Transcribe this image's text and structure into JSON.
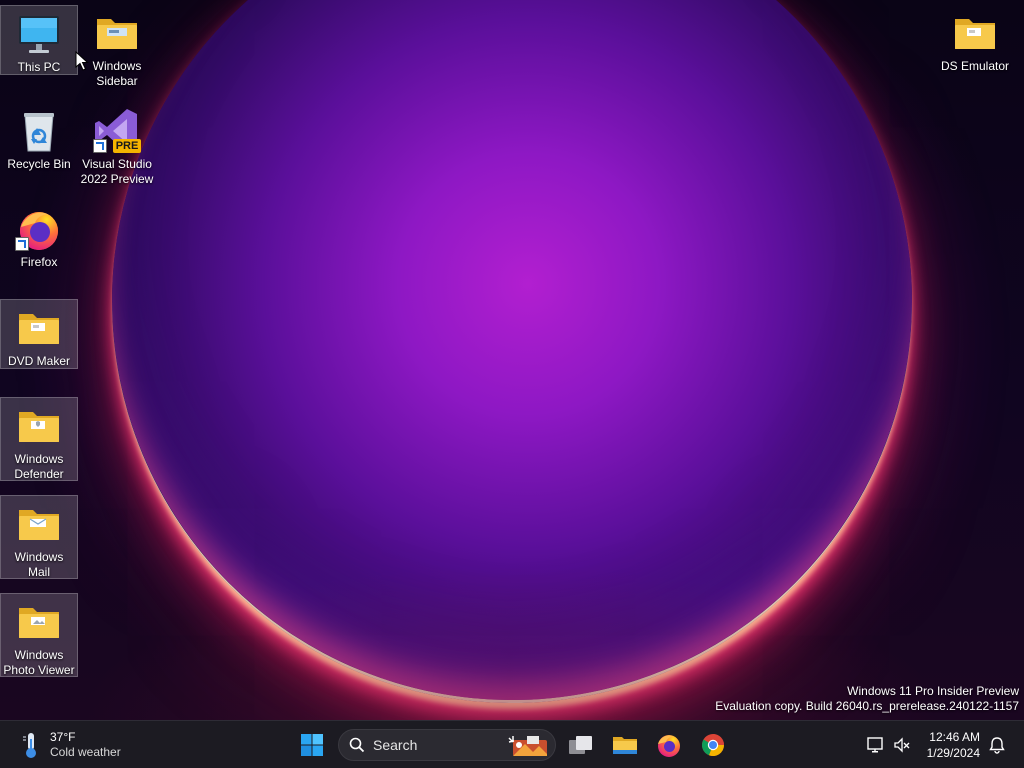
{
  "desktop_icons": {
    "this_pc": "This PC",
    "windows_sidebar": "Windows\nSidebar",
    "ds_emulator": "DS Emulator",
    "recycle_bin": "Recycle Bin",
    "visual_studio": "Visual Studio\n2022 Preview",
    "visual_studio_badge": "PRE",
    "firefox": "Firefox",
    "dvd_maker": "DVD Maker",
    "windows_defender": "Windows\nDefender",
    "windows_mail": "Windows\nMail",
    "windows_photo_viewer": "Windows\nPhoto Viewer"
  },
  "watermark": {
    "line1": "Windows 11 Pro Insider Preview",
    "line2": "Evaluation copy. Build 26040.rs_prerelease.240122-1157"
  },
  "taskbar": {
    "weather": {
      "temperature": "37°F",
      "condition": "Cold weather",
      "icon": "thermometer-icon"
    },
    "search_label": "Search",
    "pinned": [
      "start-icon",
      "search-icon",
      "task-view-icon",
      "file-explorer-icon",
      "firefox-icon",
      "chrome-icon"
    ],
    "tray": {
      "time": "12:46 AM",
      "date": "1/29/2024",
      "icons": [
        "network-icon",
        "volume-muted-icon",
        "notification-bell-icon"
      ]
    }
  },
  "colors": {
    "taskbar_bg": "#1c1b22",
    "folder_yellow": "#f5c542",
    "windows_blue": "#2aa6f2"
  }
}
